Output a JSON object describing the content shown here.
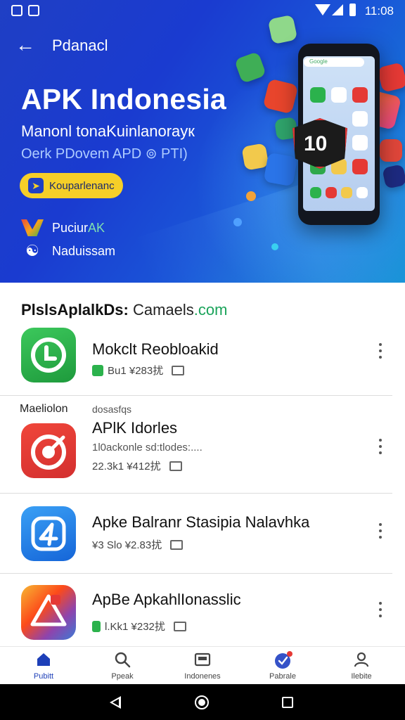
{
  "status_bar": {
    "time": "11:08"
  },
  "top_bar": {
    "title": "Pdanacl"
  },
  "hero": {
    "title": "APK Indonesia",
    "subtitle_line1": "Manonl tonaKuinlanoraук",
    "subtitle_line2": "Oerk PDovem APD ⊚ PTI)",
    "cta_label": "Kouparlenanc",
    "badges": [
      {
        "icon": "w-logo-icon",
        "text": "Puciur ",
        "accent": "AK"
      },
      {
        "icon": "people-icon",
        "text": "Naduissam",
        "accent": ""
      }
    ],
    "phone_search_text": "Google",
    "badge_number": "10"
  },
  "section": {
    "title_bold": "PlslsAplalkDs:",
    "title_domain": "Camaels",
    "title_tld": ".com"
  },
  "category": {
    "left": "Maeliolon",
    "right": "dosasfqs"
  },
  "apps": [
    {
      "name": "Mokclt Reobloakid",
      "description": "",
      "meta_rating": "Bu1 ¥283扰",
      "icon_color": "#2bb24c"
    },
    {
      "name": "APlK Idorles",
      "description": "1l0ackonle sd:tlodes:....",
      "meta_rating": "22.3k1 ¥412扰",
      "icon_color": "#e53935"
    },
    {
      "name": "Apke Balranr Stasipia Nalavhka",
      "description": "",
      "meta_rating": "¥3 Slo ¥2.83扰",
      "icon_color": "#1e88e5"
    },
    {
      "name": "ApBe ApkahlIonasslic",
      "description": "",
      "meta_rating": "l.Kk1 ¥232扰",
      "icon_color": "#fb8c00"
    }
  ],
  "bottom_nav": [
    {
      "label": "Pubitt",
      "icon": "home-icon",
      "active": true
    },
    {
      "label": "Ppeak",
      "icon": "search-icon",
      "active": false
    },
    {
      "label": "Indonenes",
      "icon": "apps-icon",
      "active": false
    },
    {
      "label": "Pabrale",
      "icon": "check-badge-icon",
      "active": false
    },
    {
      "label": "Ilebite",
      "icon": "person-icon",
      "active": false
    }
  ]
}
